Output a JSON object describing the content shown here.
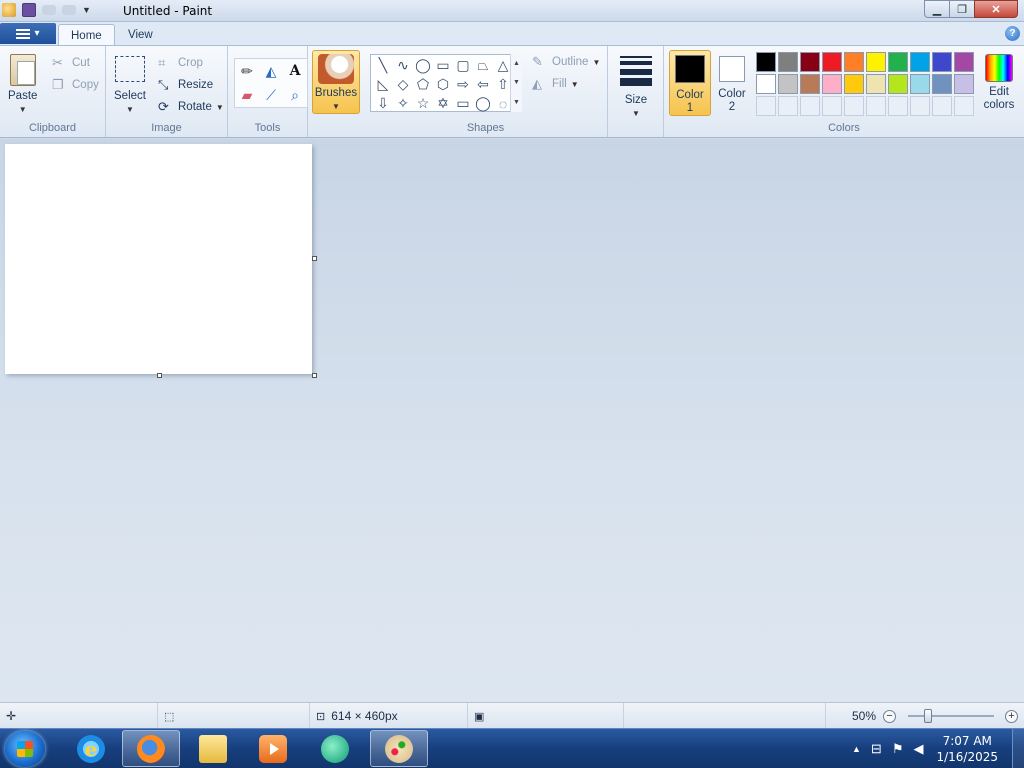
{
  "window": {
    "title": "Untitled - Paint"
  },
  "tabs": {
    "home": "Home",
    "view": "View"
  },
  "help_glyph": "?",
  "clipboard": {
    "label": "Clipboard",
    "paste": "Paste",
    "cut": "Cut",
    "copy": "Copy"
  },
  "image": {
    "label": "Image",
    "select": "Select",
    "crop": "Crop",
    "resize": "Resize",
    "rotate": "Rotate"
  },
  "tools": {
    "label": "Tools"
  },
  "brushes": {
    "label": "Brushes"
  },
  "shapes": {
    "label": "Shapes",
    "outline": "Outline",
    "fill": "Fill"
  },
  "size": {
    "label": "Size"
  },
  "colors": {
    "label": "Colors",
    "color1": "Color 1",
    "color2": "Color 2",
    "edit": "Edit colors",
    "color1_value": "#000000",
    "color2_value": "#ffffff",
    "palette_row1": [
      "#000000",
      "#7f7f7f",
      "#880015",
      "#ed1c24",
      "#ff7f27",
      "#fff200",
      "#22b14c",
      "#00a2e8",
      "#3f48cc",
      "#a349a4"
    ],
    "palette_row2": [
      "#ffffff",
      "#c3c3c3",
      "#b97a57",
      "#ffaec9",
      "#ffc90e",
      "#efe4b0",
      "#b5e61d",
      "#99d9ea",
      "#7092be",
      "#c8bfe7"
    ]
  },
  "status": {
    "dimensions": "614 × 460px",
    "zoom": "50%"
  },
  "taskbar": {
    "time": "7:07 AM",
    "date": "1/16/2025"
  }
}
